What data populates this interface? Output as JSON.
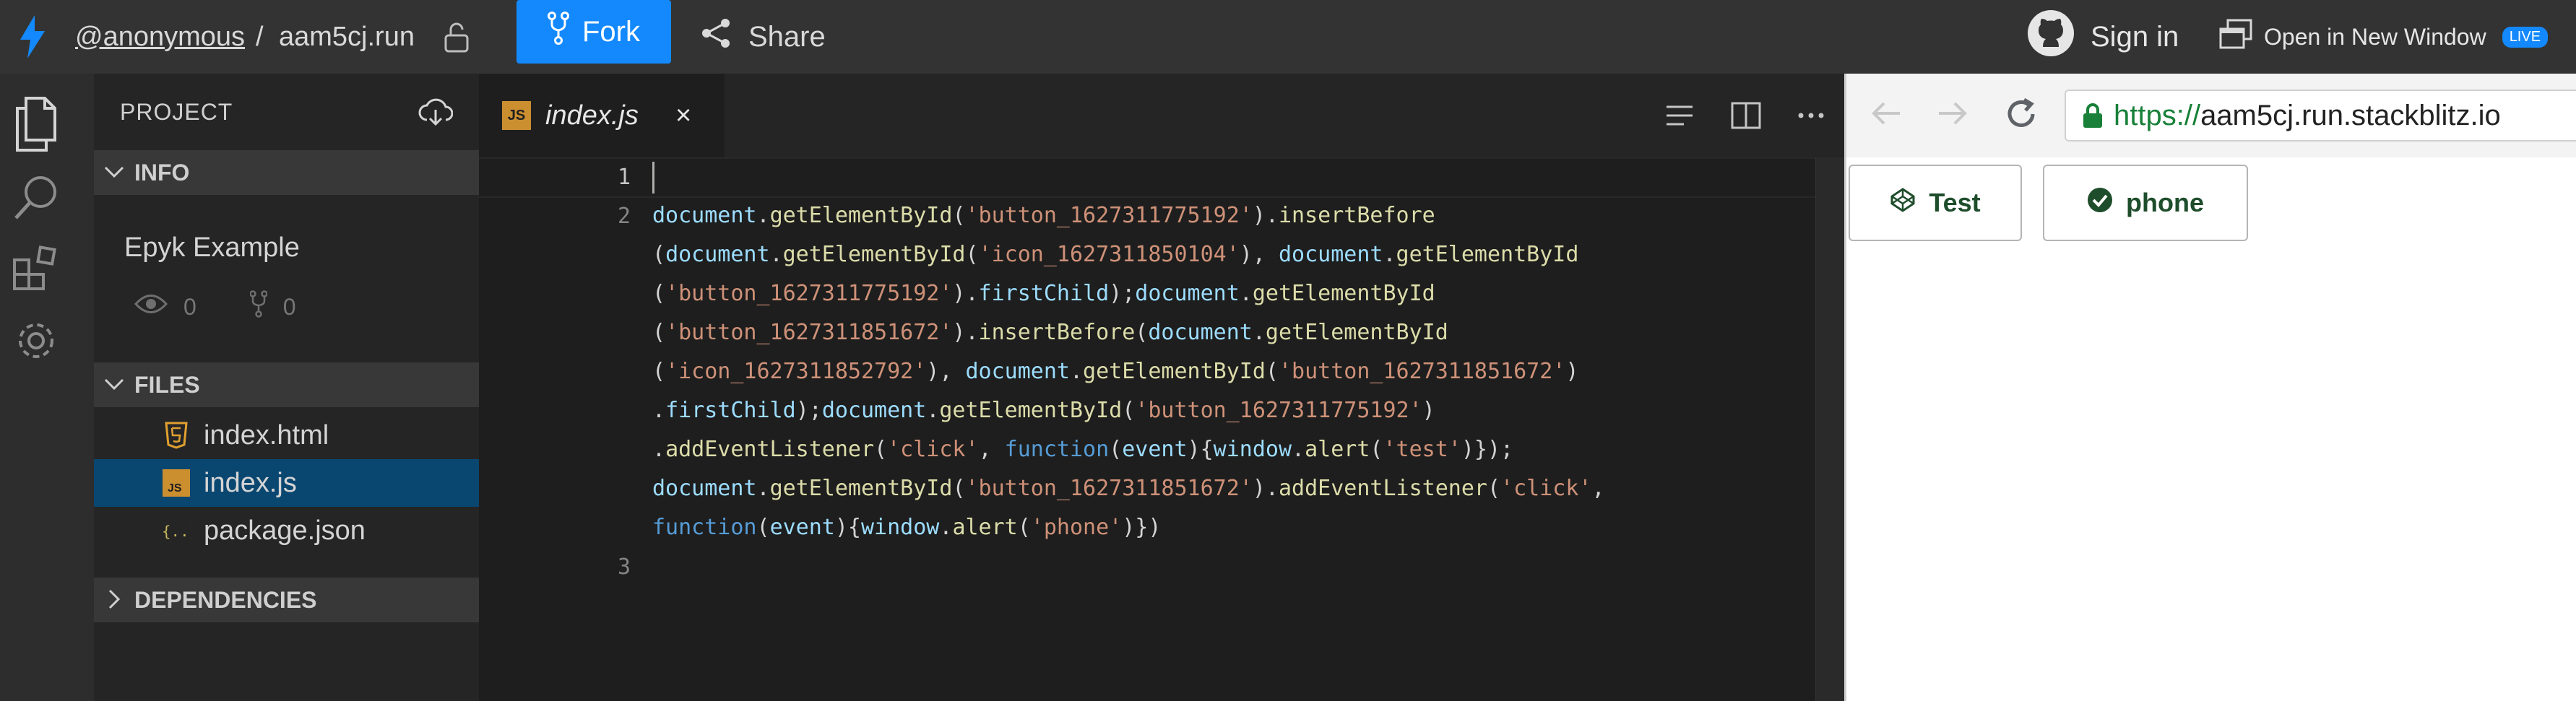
{
  "topbar": {
    "user": "@anonymous",
    "slash": "/",
    "project": "aam5cj.run",
    "fork_label": "Fork",
    "share_label": "Share",
    "signin_label": "Sign in",
    "open_new_window_label": "Open in New Window",
    "live_badge": "LIVE",
    "accent_color": "#1389fd"
  },
  "sidebar": {
    "project_header": "PROJECT",
    "info": {
      "header": "INFO",
      "title": "Epyk Example",
      "views": "0",
      "forks": "0"
    },
    "files": {
      "header": "FILES",
      "items": [
        {
          "name": "index.html",
          "icon": "html5-icon"
        },
        {
          "name": "index.js",
          "icon": "js-icon",
          "active": true
        },
        {
          "name": "package.json",
          "icon": "json-icon"
        }
      ]
    },
    "dependencies_header": "DEPENDENCIES"
  },
  "editor": {
    "tab": {
      "label": "index.js",
      "icon_text": "JS",
      "close": "×"
    },
    "line_numbers": [
      "1",
      "2",
      "3"
    ],
    "code_lines": [
      [
        [
          "c-id",
          "document"
        ],
        [
          "c-p",
          "."
        ],
        [
          "c-fn",
          "getElementById"
        ],
        [
          "c-p",
          "("
        ],
        [
          "c-str",
          "'button_1627311775192'"
        ],
        [
          "c-p",
          ")."
        ],
        [
          "c-fn",
          "insertBefore"
        ]
      ],
      [
        [
          "c-p",
          "("
        ],
        [
          "c-id",
          "document"
        ],
        [
          "c-p",
          "."
        ],
        [
          "c-fn",
          "getElementById"
        ],
        [
          "c-p",
          "("
        ],
        [
          "c-str",
          "'icon_1627311850104'"
        ],
        [
          "c-p",
          "), "
        ],
        [
          "c-id",
          "document"
        ],
        [
          "c-p",
          "."
        ],
        [
          "c-fn",
          "getElementById"
        ]
      ],
      [
        [
          "c-p",
          "("
        ],
        [
          "c-str",
          "'button_1627311775192'"
        ],
        [
          "c-p",
          ")."
        ],
        [
          "c-id",
          "firstChild"
        ],
        [
          "c-p",
          ");"
        ],
        [
          "c-id",
          "document"
        ],
        [
          "c-p",
          "."
        ],
        [
          "c-fn",
          "getElementById"
        ]
      ],
      [
        [
          "c-p",
          "("
        ],
        [
          "c-str",
          "'button_1627311851672'"
        ],
        [
          "c-p",
          ")."
        ],
        [
          "c-fn",
          "insertBefore"
        ],
        [
          "c-p",
          "("
        ],
        [
          "c-id",
          "document"
        ],
        [
          "c-p",
          "."
        ],
        [
          "c-fn",
          "getElementById"
        ]
      ],
      [
        [
          "c-p",
          "("
        ],
        [
          "c-str",
          "'icon_1627311852792'"
        ],
        [
          "c-p",
          "), "
        ],
        [
          "c-id",
          "document"
        ],
        [
          "c-p",
          "."
        ],
        [
          "c-fn",
          "getElementById"
        ],
        [
          "c-p",
          "("
        ],
        [
          "c-str",
          "'button_1627311851672'"
        ],
        [
          "c-p",
          ")"
        ]
      ],
      [
        [
          "c-p",
          "."
        ],
        [
          "c-id",
          "firstChild"
        ],
        [
          "c-p",
          ");"
        ],
        [
          "c-id",
          "document"
        ],
        [
          "c-p",
          "."
        ],
        [
          "c-fn",
          "getElementById"
        ],
        [
          "c-p",
          "("
        ],
        [
          "c-str",
          "'button_1627311775192'"
        ],
        [
          "c-p",
          ")"
        ]
      ],
      [
        [
          "c-p",
          "."
        ],
        [
          "c-fn",
          "addEventListener"
        ],
        [
          "c-p",
          "("
        ],
        [
          "c-str",
          "'click'"
        ],
        [
          "c-p",
          ", "
        ],
        [
          "c-kw",
          "function"
        ],
        [
          "c-p",
          "("
        ],
        [
          "c-id",
          "event"
        ],
        [
          "c-p",
          "){"
        ],
        [
          "c-id",
          "window"
        ],
        [
          "c-p",
          "."
        ],
        [
          "c-fn",
          "alert"
        ],
        [
          "c-p",
          "("
        ],
        [
          "c-str",
          "'test'"
        ],
        [
          "c-p",
          ")});"
        ]
      ],
      [
        [
          "c-id",
          "document"
        ],
        [
          "c-p",
          "."
        ],
        [
          "c-fn",
          "getElementById"
        ],
        [
          "c-p",
          "("
        ],
        [
          "c-str",
          "'button_1627311851672'"
        ],
        [
          "c-p",
          ")."
        ],
        [
          "c-fn",
          "addEventListener"
        ],
        [
          "c-p",
          "("
        ],
        [
          "c-str",
          "'click'"
        ],
        [
          "c-p",
          ","
        ]
      ],
      [
        [
          "c-kw",
          "function"
        ],
        [
          "c-p",
          "("
        ],
        [
          "c-id",
          "event"
        ],
        [
          "c-p",
          "){"
        ],
        [
          "c-id",
          "window"
        ],
        [
          "c-p",
          "."
        ],
        [
          "c-fn",
          "alert"
        ],
        [
          "c-p",
          "("
        ],
        [
          "c-str",
          "'phone'"
        ],
        [
          "c-p",
          ")})"
        ]
      ]
    ]
  },
  "preview": {
    "url_protocol": "https://",
    "url_host": "aam5cj.run.stackblitz.io",
    "buttons": [
      {
        "label": "Test",
        "icon": "codepen-icon"
      },
      {
        "label": "phone",
        "icon": "check-circle-icon"
      }
    ]
  }
}
